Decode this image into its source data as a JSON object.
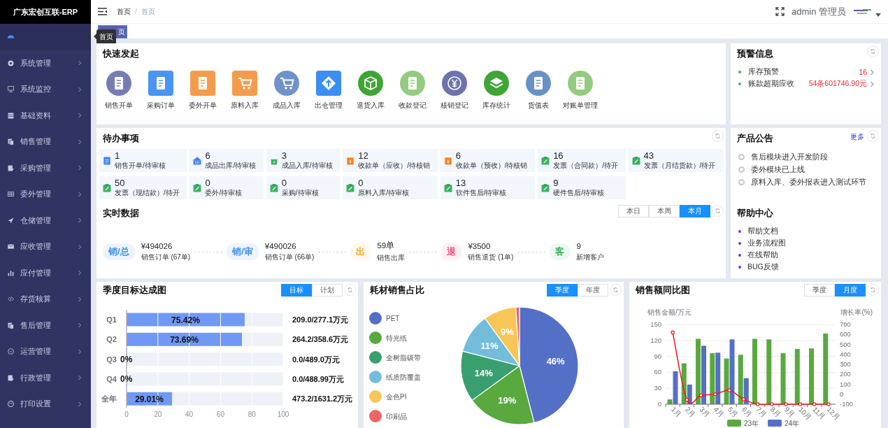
{
  "app": {
    "title": "广东宏创互联-ERP"
  },
  "sidebar": {
    "items": [
      {
        "selected": true
      },
      {
        "label": "系统管理",
        "selected": false
      },
      {
        "label": "系统监控",
        "selected": false
      },
      {
        "label": "基础资料",
        "selected": false
      },
      {
        "label": "销售管理",
        "selected": false
      },
      {
        "label": "采购管理",
        "selected": false
      },
      {
        "label": "委外管理",
        "selected": false
      },
      {
        "label": "仓储管理",
        "selected": false
      },
      {
        "label": "应收管理",
        "selected": false
      },
      {
        "label": "应付管理",
        "selected": false
      },
      {
        "label": "存货核算",
        "selected": false
      },
      {
        "label": "售后管理",
        "selected": false
      },
      {
        "label": "运营管理",
        "selected": false
      },
      {
        "label": "行政管理",
        "selected": false
      },
      {
        "label": "打印设置",
        "selected": false
      }
    ]
  },
  "header": {
    "breadcrumb": [
      "首页",
      "首页"
    ],
    "breadcrumb_separator": "/",
    "user": "admin 管理员"
  },
  "tabs": [
    {
      "label": "页",
      "selected": true
    }
  ],
  "tooltip": "首页",
  "quick_start": {
    "title": "快速发起",
    "items": [
      "销售开单",
      "采购订单",
      "委外开单",
      "原料入库",
      "成品入库",
      "出仓管理",
      "退货入库",
      "收款登记",
      "核销登记",
      "库存统计",
      "货值表",
      "对账单管理"
    ]
  },
  "warnings": {
    "title": "预警信息",
    "items": [
      {
        "label": "库存预警",
        "value": "16"
      },
      {
        "label": "账款超期应收",
        "value": "54条601746.90元"
      }
    ]
  },
  "todo": {
    "title": "待办事项",
    "items": [
      {
        "count": "1",
        "label": "销售开单/待审核"
      },
      {
        "count": "6",
        "label": "成品出库/待审核"
      },
      {
        "count": "3",
        "label": "成品入库/待审核"
      },
      {
        "count": "12",
        "label": "收款单（应收）/待核销"
      },
      {
        "count": "6",
        "label": "收款单（预收）/待核销"
      },
      {
        "count": "16",
        "label": "发票（合同款）/待开"
      },
      {
        "count": "43",
        "label": "发票（月结货款）/待开"
      },
      {
        "count": "50",
        "label": "发票（现结款）/待开"
      },
      {
        "count": "0",
        "label": "委外/待审核"
      },
      {
        "count": "0",
        "label": "采购/待审核"
      },
      {
        "count": "0",
        "label": "原料入库/待审核"
      },
      {
        "count": "13",
        "label": "软件售后/待审核"
      },
      {
        "count": "9",
        "label": "硬件售后/待审核"
      }
    ]
  },
  "announcements": {
    "title": "产品公告",
    "more": "更多",
    "items": [
      "售后模块进入开发阶段",
      "委外模块已上线",
      "原料入库、委外报表进入测试环节"
    ]
  },
  "realtime": {
    "title": "实时数据",
    "ranges": [
      {
        "label": "本日",
        "selected": false
      },
      {
        "label": "本周",
        "selected": false
      },
      {
        "label": "本月",
        "selected": true
      }
    ],
    "items": [
      {
        "badge": "销/总",
        "color": "#3d8ff5",
        "amount": "¥494026",
        "label": "销售订单 (67单)"
      },
      {
        "badge": "销/审",
        "color": "#3d8ff5",
        "amount": "¥490026",
        "label": "销售订单 (66单)"
      },
      {
        "badge": "出",
        "color": "#f5a623",
        "amount": "59单",
        "label": "销售出库"
      },
      {
        "badge": "退",
        "color": "#f0507a",
        "amount": "¥3500",
        "label": "销售退货 (1单)"
      },
      {
        "badge": "客",
        "color": "#3cb062",
        "amount": "9",
        "label": "新增客户"
      }
    ]
  },
  "help": {
    "title": "帮助中心",
    "items": [
      "帮助文档",
      "业务流程图",
      "在线帮助",
      "BUG反馈"
    ]
  },
  "quarter_chart": {
    "title": "季度目标达成图",
    "modes": [
      {
        "label": "目标",
        "selected": true
      },
      {
        "label": "计划",
        "selected": false
      }
    ],
    "totals": [
      "209.0/277.1万元",
      "264.2/358.6万元",
      "0.0/489.0万元",
      "0.0/488.99万元",
      "473.2/1631.2万元"
    ],
    "chart_data": {
      "type": "bar",
      "orientation": "horizontal",
      "categories": [
        "Q1",
        "Q2",
        "Q3",
        "Q4",
        "全年"
      ],
      "stacked": true,
      "series": [
        {
          "color": "#7099f5",
          "values": [
            75.42,
            73.69,
            0,
            0,
            29.01
          ]
        },
        {
          "color": "#eef1f8",
          "values": [
            24.58,
            26.31,
            100,
            100,
            70.99
          ]
        }
      ],
      "value_labels": [
        "75.42%",
        "73.69%",
        "0%",
        "0%",
        "29.01%"
      ],
      "xlim": [
        0,
        100
      ],
      "xticks": [
        0,
        20,
        40,
        60,
        80,
        100
      ],
      "grid": true
    }
  },
  "material_chart": {
    "title": "耗材销售占比",
    "modes": [
      {
        "label": "季度",
        "selected": true
      },
      {
        "label": "年度",
        "selected": false
      }
    ],
    "chart_data": {
      "type": "pie",
      "legend": "left",
      "categories": [
        "PET",
        "特光纸",
        "全树脂碳带",
        "纸质防覆盖",
        "金色PI",
        "印刷品"
      ],
      "values": [
        46,
        19,
        14,
        11,
        9,
        1
      ],
      "colors": [
        "#5470c6",
        "#59a93f",
        "#3a9f6e",
        "#73bddb",
        "#f8c657",
        "#ec6664"
      ],
      "value_labels": [
        "46%",
        "19%",
        "14%",
        "11%",
        "9%",
        null
      ]
    }
  },
  "sales_chart": {
    "title": "销售额同比图",
    "modes": [
      {
        "label": "季度",
        "selected": false
      },
      {
        "label": "月度",
        "selected": true
      }
    ],
    "chart_data": {
      "type": "bar",
      "categories": [
        "1月",
        "2月",
        "3月",
        "4月",
        "5月",
        "6月",
        "7月",
        "8月",
        "9月",
        "10月",
        "11月",
        "12月"
      ],
      "legend": "bottom",
      "grid": true,
      "ylabel": "销售金额/万元",
      "y2label": "增长率(%)",
      "ylim": [
        0,
        150
      ],
      "yticks": [
        0,
        30,
        60,
        90,
        120,
        150
      ],
      "y2lim": [
        -100,
        700
      ],
      "y2ticks": [
        -100,
        0,
        100,
        200,
        300,
        400,
        500,
        600,
        700
      ],
      "series": [
        {
          "name": "23年",
          "color": "#59a93f",
          "values": [
            9,
            77,
            123,
            96,
            86,
            93,
            123,
            122,
            96,
            104,
            105,
            133
          ]
        },
        {
          "name": "24年",
          "color": "#5470c6",
          "values": [
            62,
            37,
            110,
            97,
            122,
            49,
            null,
            null,
            null,
            null,
            null,
            null
          ]
        },
        {
          "type": "line",
          "axis": "y2",
          "marker": true,
          "color": "#f01818",
          "values": [
            620,
            -55,
            -10,
            0,
            40,
            -50,
            -100,
            -100,
            -100,
            -100,
            -100,
            -100
          ]
        }
      ]
    }
  }
}
